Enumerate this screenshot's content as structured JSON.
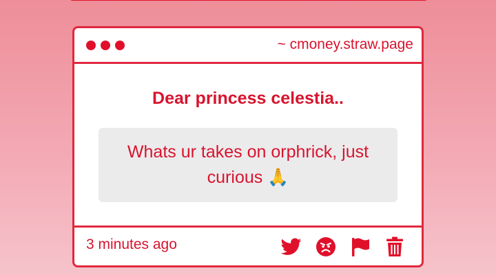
{
  "card": {
    "site_url": "~ cmoney.straw.page",
    "title": "Dear princess celestia..",
    "message": "Whats ur takes on orphrick, just curious 🙏",
    "timestamp": "3 minutes ago"
  },
  "icons": {
    "share": "twitter-icon",
    "react": "angry-face-icon",
    "report": "flag-icon",
    "delete": "trash-icon"
  },
  "colors": {
    "accent": "#e0102b",
    "message_background": "#ecebec",
    "page_gradient_top": "#ee8e99",
    "page_gradient_bottom": "#f6c3cb"
  }
}
